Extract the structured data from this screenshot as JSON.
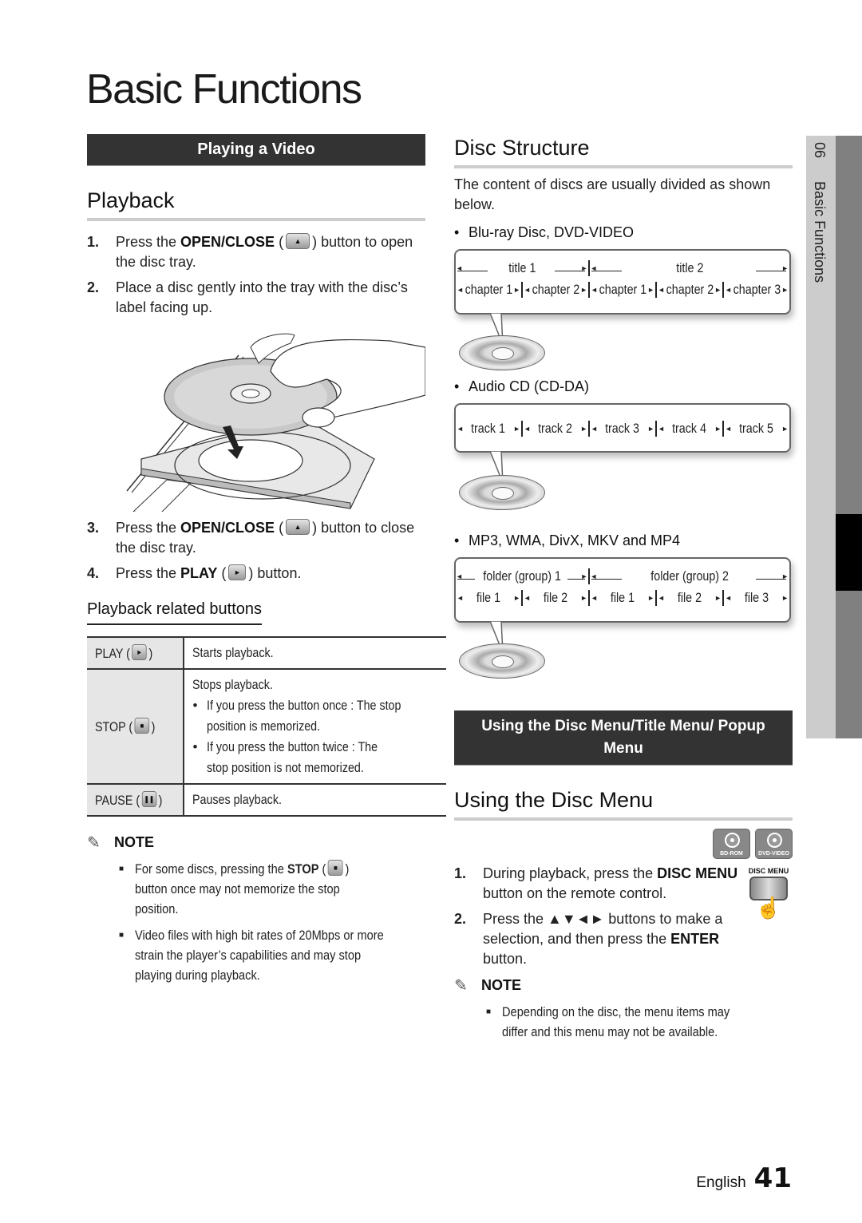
{
  "page": {
    "title": "Basic Functions",
    "side_tab": {
      "chapter_number": "06",
      "chapter_title": "Basic Functions"
    },
    "footer": {
      "language": "English",
      "page_number": "41"
    }
  },
  "left": {
    "section_bar": "Playing a Video",
    "heading": "Playback",
    "steps_a": [
      {
        "num": "1.",
        "pre": "Press the ",
        "bold": "OPEN/CLOSE",
        "icon": "eject-button-icon",
        "post": " button to open the disc tray."
      },
      {
        "num": "2.",
        "text": "Place a disc gently into the tray with the disc’s label facing up."
      }
    ],
    "steps_b": [
      {
        "num": "3.",
        "pre": "Press the ",
        "bold": "OPEN/CLOSE",
        "icon": "eject-button-icon",
        "post": " button to close the disc tray."
      },
      {
        "num": "4.",
        "pre": "Press the ",
        "bold": "PLAY",
        "icon": "play-button-icon",
        "post": " button."
      }
    ],
    "subheading": "Playback related buttons",
    "table": [
      {
        "key": "PLAY",
        "icon": "play-button-icon",
        "value": "Starts playback.",
        "bullets": []
      },
      {
        "key": "STOP",
        "icon": "stop-button-icon",
        "value": "Stops playback.",
        "bullets": [
          "If you press the button once : The stop position is memorized.",
          "If you press the button twice : The stop position is not memorized."
        ]
      },
      {
        "key": "PAUSE",
        "icon": "pause-button-icon",
        "value": "Pauses playback.",
        "bullets": []
      }
    ],
    "note": {
      "label": "NOTE",
      "items": [
        {
          "pre": "For some discs, pressing the ",
          "bold": "STOP",
          "post": " button once may not memorize the stop position."
        },
        {
          "text": "Video files with high bit rates of 20Mbps or more strain the player’s capabilities and may stop playing during playback."
        }
      ]
    }
  },
  "right": {
    "heading": "Disc Structure",
    "intro": "The content of discs are usually divided as shown below.",
    "diagrams": [
      {
        "label": "Blu-ray Disc, DVD-VIDEO",
        "groups": [
          "title 1",
          "title 2"
        ],
        "items": [
          "chapter 1",
          "chapter 2",
          "chapter 1",
          "chapter 2",
          "chapter 3"
        ]
      },
      {
        "label": "Audio CD (CD-DA)",
        "groups": [],
        "items": [
          "track 1",
          "track 2",
          "track 3",
          "track 4",
          "track 5"
        ]
      },
      {
        "label": "MP3, WMA, DivX, MKV and MP4",
        "groups": [
          "folder (group) 1",
          "folder (group) 2"
        ],
        "items": [
          "file 1",
          "file 2",
          "file 1",
          "file 2",
          "file 3"
        ]
      }
    ],
    "section_bar": "Using the Disc Menu/Title Menu/ Popup Menu",
    "heading2": "Using the Disc Menu",
    "badges": [
      "BD-ROM",
      "DVD-VIDEO"
    ],
    "remote_label": "DISC MENU",
    "steps": [
      {
        "num": "1.",
        "pre": "During playback, press the ",
        "bold": "DISC MENU",
        "post": " button on the remote control."
      },
      {
        "num": "2.",
        "pre": "Press the ▲▼◄► buttons to make a selection, and then press the ",
        "bold": "ENTER",
        "post": " button."
      }
    ],
    "note": {
      "label": "NOTE",
      "items": [
        "Depending on the disc, the menu items may differ and this menu may not be available."
      ]
    }
  }
}
